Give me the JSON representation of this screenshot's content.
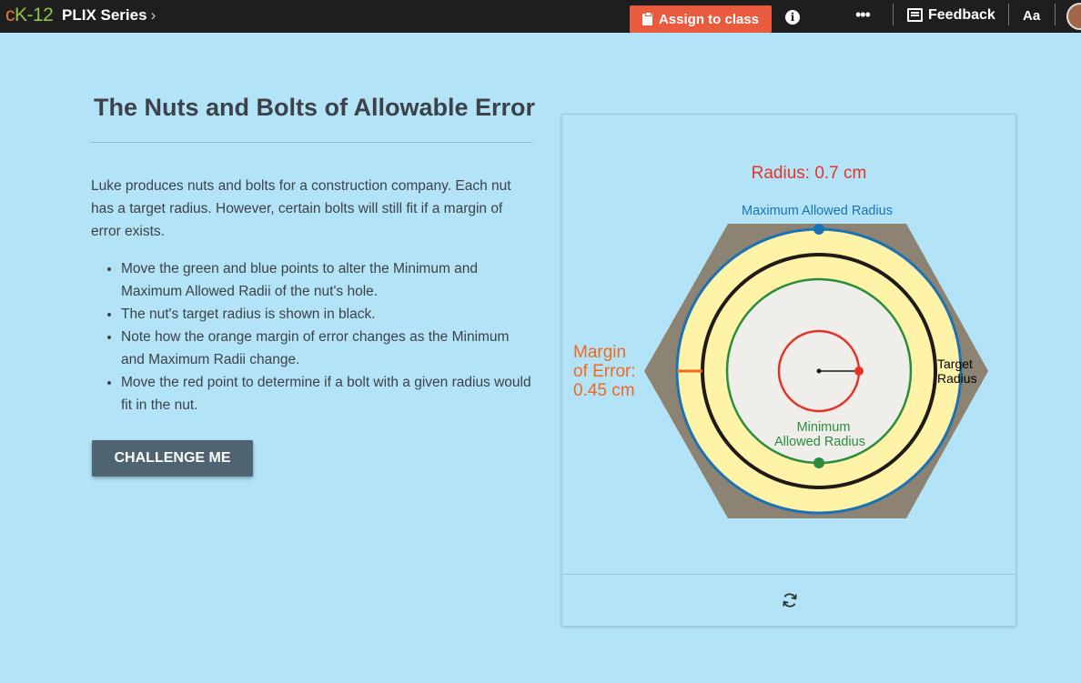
{
  "topbar": {
    "logo_c": "c",
    "logo_k12": "K-12",
    "series_label": "PLIX Series",
    "series_chevron": "›",
    "assign_label": "Assign to class",
    "info_glyph": "i",
    "more_glyph": "•••",
    "feedback_label": "Feedback",
    "text_size_label": "Aa",
    "assign_color": "#e95b3f"
  },
  "content": {
    "title": "The Nuts and Bolts of Allowable Error",
    "intro": "Luke produces nuts and bolts for a construction company. Each nut has a target radius.  However, certain bolts will still fit if a margin of error exists.",
    "bullets": [
      "Move the green and blue points to alter the Minimum and Maximum Allowed Radii of the nut's hole.",
      "The nut's target radius is shown in black.",
      "Note how the orange margin of error changes as the Minimum and Maximum Radii change.",
      "Move the red point to determine if a bolt with a given radius would fit in the nut."
    ],
    "challenge_label": "CHALLENGE ME"
  },
  "diagram": {
    "radius_readout": "Radius: 0.7 cm",
    "max_label": "Maximum Allowed Radius",
    "min_label_line1": "Minimum",
    "min_label_line2": "Allowed Radius",
    "target_label_line1": "Target",
    "target_label_line2": "Radius",
    "margin_line1": "Margin",
    "margin_line2": "of Error:",
    "margin_line3": "0.45 cm",
    "colors": {
      "hex": "#8c8373",
      "band": "#fff3a8",
      "inner": "#efeeea",
      "max": "#1a73b5",
      "target": "#1f1a17",
      "min": "#2a8d3c",
      "bolt": "#e5332a",
      "margin": "#ee6a1f"
    }
  },
  "reset_icon": "refresh-icon"
}
